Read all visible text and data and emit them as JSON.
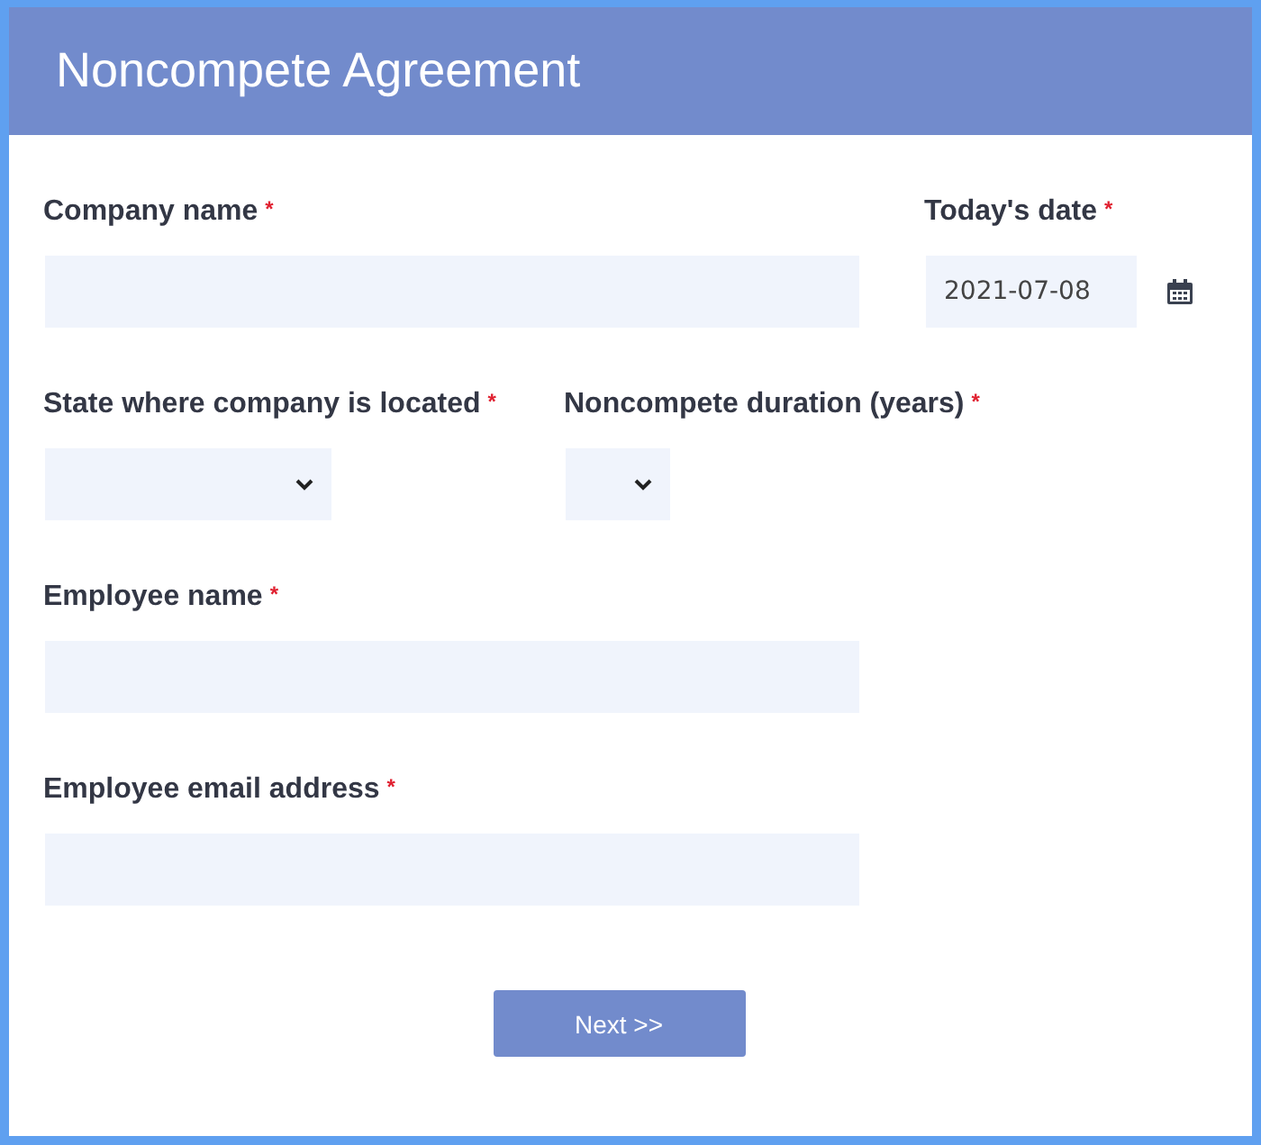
{
  "title": "Noncompete Agreement",
  "rows": [
    [
      {
        "kind": "text",
        "label": "Company name",
        "asterisk": "*"
      },
      {
        "kind": "date",
        "label": "Today's date",
        "asterisk": "*",
        "value": "2021-07-08"
      }
    ],
    [
      {
        "kind": "select",
        "label": "State where company is located",
        "asterisk": "*"
      },
      {
        "kind": "select",
        "label": "Noncompete duration (years)",
        "asterisk": "*"
      }
    ],
    [
      {
        "kind": "text",
        "label": "Employee name",
        "asterisk": "*"
      }
    ],
    [
      {
        "kind": "text",
        "label": "Employee email address",
        "asterisk": "*"
      }
    ]
  ],
  "button": "Next >>"
}
